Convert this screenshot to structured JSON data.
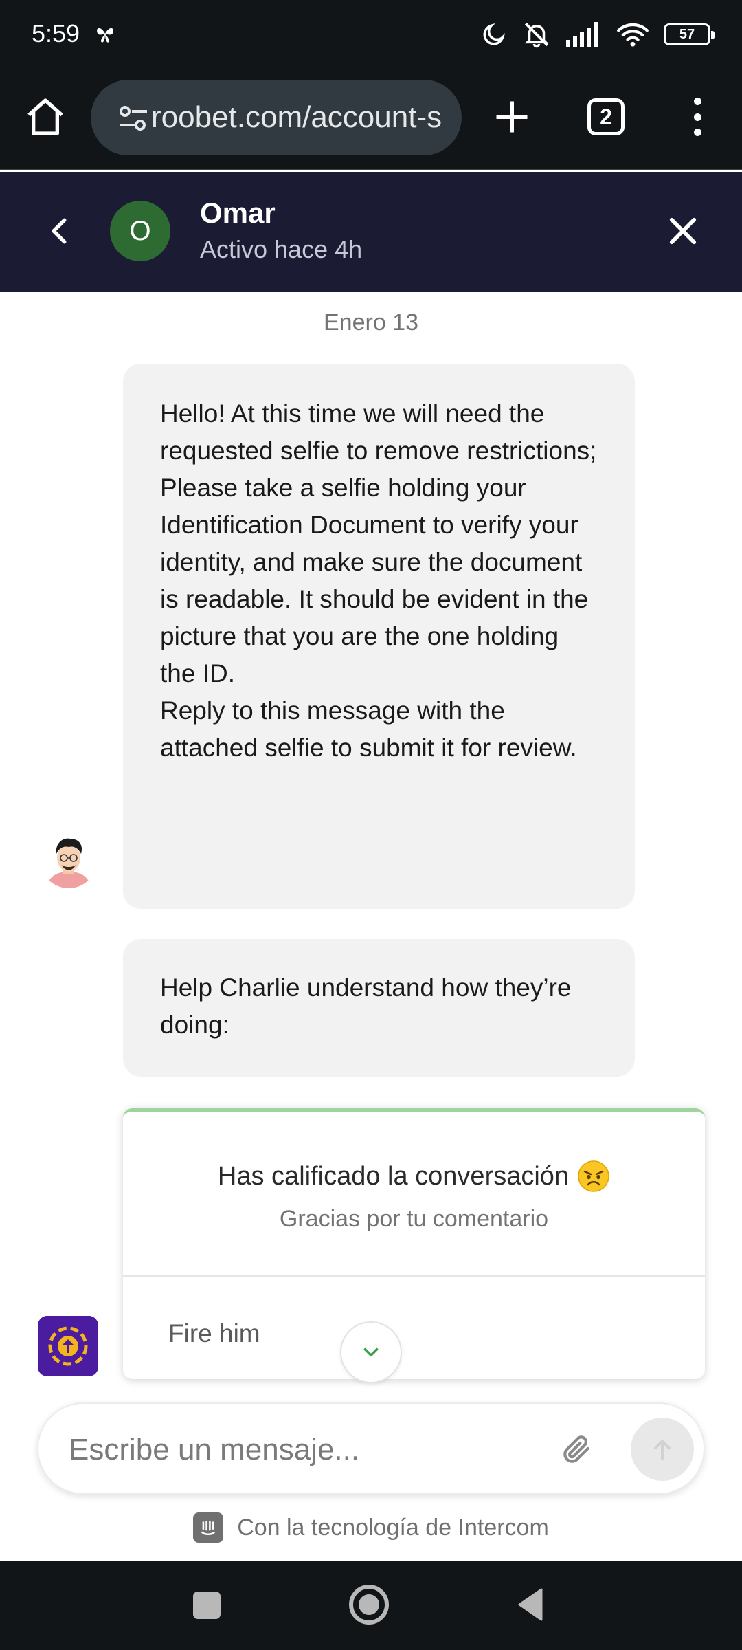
{
  "status_bar": {
    "time": "5:59",
    "battery": "57"
  },
  "browser": {
    "url": "roobet.com/account-s",
    "tab_count": "2"
  },
  "chat_header": {
    "contact_initial": "O",
    "contact_name": "Omar",
    "contact_status": "Activo hace 4h"
  },
  "conversation": {
    "date_label": "Enero 13",
    "message_1": {
      "lines": [
        "Hello! At this time we will need the requested selfie to remove restrictions;",
        "Please take a selfie holding your Identification Document to verify your identity, and make sure the document is readable. It should be evident in the picture that you are the one holding the ID.",
        "Reply to this message with the attached selfie to submit it for review."
      ]
    },
    "message_2": "Help Charlie understand how they’re doing:",
    "rating": {
      "title": "Has calificado la conversación",
      "emoji": "angry-face-emoji",
      "subtitle": "Gracias por tu comentario",
      "comment": "Fire him"
    }
  },
  "composer": {
    "placeholder": "Escribe un mensaje..."
  },
  "footer": {
    "powered_by": "Con la tecnología de Intercom"
  },
  "colors": {
    "header_bg": "#1b1c34",
    "browser_bg": "#121517",
    "avatar_green": "#2e6b32",
    "rating_accent": "#9fd39f",
    "brand_purple": "#4b1ba0"
  }
}
